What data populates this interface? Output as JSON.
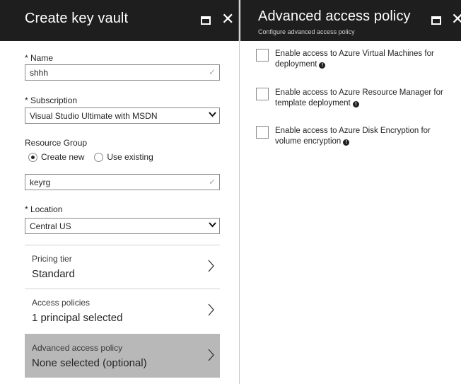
{
  "left_blade": {
    "title": "Create key vault",
    "name_label": "* Name",
    "name_value": "shhh",
    "subscription_label": "* Subscription",
    "subscription_value": "Visual Studio Ultimate with MSDN",
    "resource_group_label": "Resource Group",
    "radio_create_new": "Create new",
    "radio_use_existing": "Use existing",
    "radio_selected": "create_new",
    "resource_group_value": "keyrg",
    "location_label": "* Location",
    "location_value": "Central US",
    "nav": [
      {
        "small": "Pricing tier",
        "big": "Standard",
        "selected": false
      },
      {
        "small": "Access policies",
        "big": "1 principal selected",
        "selected": false
      },
      {
        "small": "Advanced access policy",
        "big": "None selected (optional)",
        "selected": true
      }
    ]
  },
  "right_blade": {
    "title": "Advanced access policy",
    "subtitle": "Configure advanced access policy",
    "options": [
      {
        "line1": "Enable access to Azure Virtual Machines for",
        "line2": "deployment",
        "checked": false
      },
      {
        "line1": "Enable access to Azure Resource Manager for",
        "line2": "template deployment",
        "checked": false
      },
      {
        "line1": "Enable access to Azure Disk Encryption for",
        "line2": "volume encryption",
        "checked": false
      }
    ]
  },
  "colors": {
    "header_bg": "#1e1e1e",
    "selected_nav_bg": "#b8b8b8",
    "text": "#252525"
  },
  "icons": [
    "maximize-icon",
    "close-icon",
    "checkmark-icon",
    "chevron-down-icon",
    "chevron-right-icon",
    "info-icon"
  ]
}
